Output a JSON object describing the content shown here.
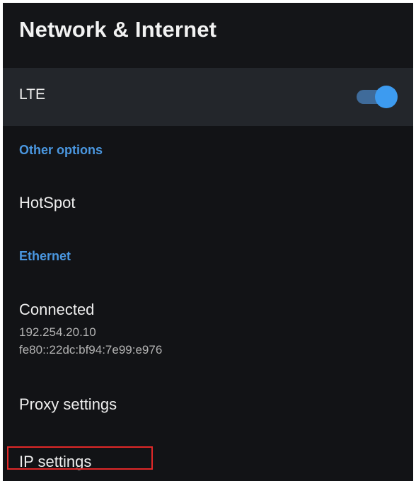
{
  "header": {
    "title": "Network & Internet"
  },
  "lte": {
    "label": "LTE",
    "enabled": true,
    "toggle_icon": "toggle-on-icon"
  },
  "sections": {
    "other_options": "Other options",
    "ethernet": "Ethernet"
  },
  "items": {
    "hotspot": "HotSpot",
    "connected": {
      "label": "Connected",
      "ipv4": "192.254.20.10",
      "ipv6": "fe80::22dc:bf94:7e99:e976"
    },
    "proxy_settings": "Proxy settings",
    "ip_settings": "IP settings"
  },
  "colors": {
    "background": "#121316",
    "lte_row": "#23262b",
    "accent": "#4a97e0",
    "toggle_knob": "#3d9bf0",
    "highlight_border": "#e12828"
  }
}
